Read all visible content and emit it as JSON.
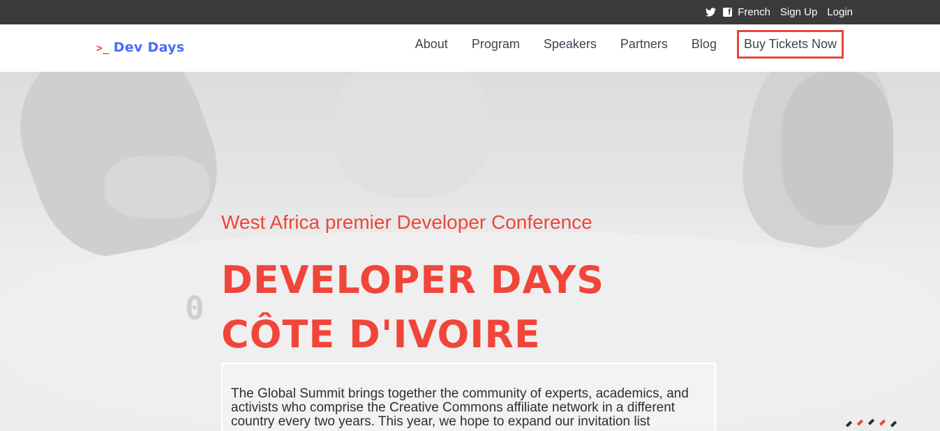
{
  "topbar": {
    "icons": [
      "twitter-icon",
      "facebook-icon"
    ],
    "language": "French",
    "signup": "Sign Up",
    "login": "Login"
  },
  "header": {
    "logo_prompt": ">_",
    "logo_text": "Dev Days",
    "nav": [
      "About",
      "Program",
      "Speakers",
      "Partners",
      "Blog"
    ],
    "cta": "Buy Tickets Now"
  },
  "hero": {
    "subtitle": "West Africa premier Developer Conference",
    "title_line1": "DEVELOPER DAYS",
    "title_line2": "CÔTE D'IVOIRE",
    "decor_digit": "0",
    "description": "The Global Summit brings together the community of experts, academics, and activists who comprise the Creative Commons affiliate network in a different country every two years. This year, we hope to expand our invitation list"
  },
  "colors": {
    "accent": "#f0453a",
    "logo": "#4a6cf7",
    "topbar": "#3b3b3b"
  }
}
